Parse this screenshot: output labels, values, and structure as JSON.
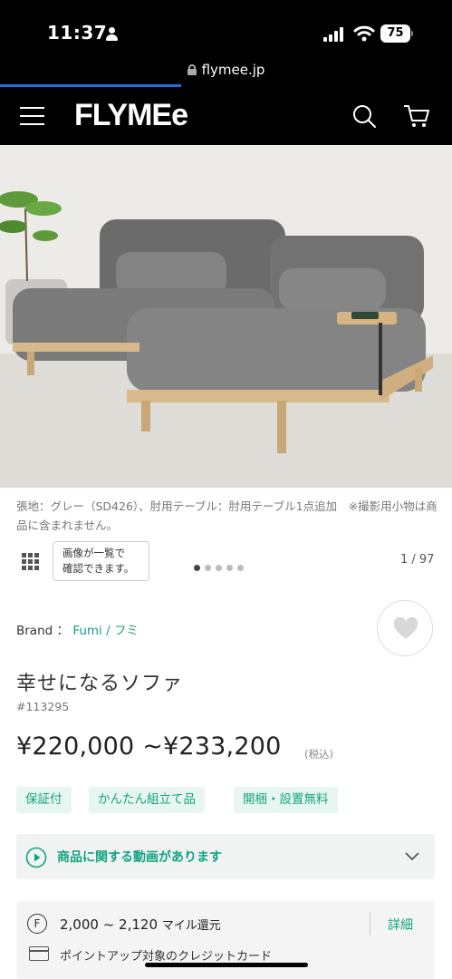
{
  "status_bar": {
    "time": "11:37",
    "battery": "75"
  },
  "browser": {
    "url": "flymee.jp",
    "load_progress_percent": 40
  },
  "nav": {
    "logo": "FLYMEe"
  },
  "gallery": {
    "caption": "張地：グレー（SD426）、肘用テーブル：肘用テーブル1点追加　※撮影用小物は商品に含まれません。",
    "list_view_tip": "画像が一覧で確認できます。",
    "list_view_tip_line1": "画像が一覧で",
    "list_view_tip_line2": "確認できます。",
    "counter": "1 / 97",
    "dots_total": 5,
    "dots_active": 1
  },
  "product": {
    "brand_label": "Brand ：",
    "brand_name": "Fumi / フミ",
    "name": "幸せになるソファ",
    "sku": "#113295",
    "price": "¥220,000 ~¥233,200",
    "tax_note": "(税込)",
    "tags": [
      "保証付",
      "かんたん組立て品",
      "開梱・設置無料"
    ]
  },
  "video": {
    "label": "商品に関する動画があります"
  },
  "mileage": {
    "symbol": "F",
    "amount": "2,000 ~ 2,120",
    "unit": "マイル還元",
    "detail_link": "詳細",
    "card_text": "ポイントアップ対象のクレジットカード"
  },
  "colors": {
    "accent": "#14a37f",
    "progress": "#1e6fe0",
    "header_bg": "#000000"
  }
}
